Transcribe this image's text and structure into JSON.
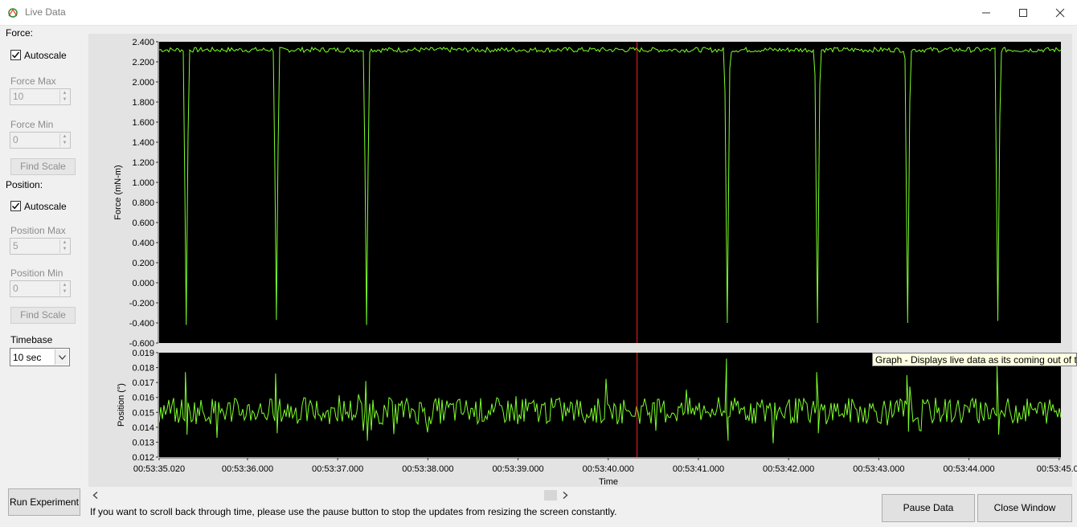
{
  "window": {
    "title": "Live Data"
  },
  "sidebar": {
    "force_section_label": "Force:",
    "force_autoscale_label": "Autoscale",
    "force_autoscale_checked": true,
    "force_max_label": "Force Max",
    "force_max_value": "10",
    "force_min_label": "Force Min",
    "force_min_value": "0",
    "force_find_scale_label": "Find Scale",
    "position_section_label": "Position:",
    "position_autoscale_label": "Autoscale",
    "position_autoscale_checked": true,
    "position_max_label": "Position Max",
    "position_max_value": "5",
    "position_min_label": "Position Min",
    "position_min_value": "0",
    "position_find_scale_label": "Find Scale",
    "timebase_label": "Timebase",
    "timebase_value": "10 sec",
    "run_experiment_label": "Run Experiment"
  },
  "footer": {
    "hint_text": "If you want to scroll back through time, please use the pause button to stop the updates from resizing the screen constantly.",
    "pause_label": "Pause Data",
    "close_label": "Close Window"
  },
  "tooltip": {
    "text": "Graph - Displays live data as its coming out of the"
  },
  "colors": {
    "trace": "#7dff2a",
    "cursor": "#ff2020",
    "plot_bg": "#000000"
  },
  "chart_data": [
    {
      "type": "line",
      "ylabel": "Force (mN-m)",
      "ylim": [
        -0.6,
        2.4
      ],
      "yticks": [
        "2.400",
        "2.200",
        "2.000",
        "1.800",
        "1.600",
        "1.400",
        "1.200",
        "1.000",
        "0.800",
        "0.600",
        "0.400",
        "0.200",
        "0.000",
        "-0.200",
        "-0.400",
        "-0.600"
      ],
      "baseline": 2.32,
      "dips": [
        {
          "t": 0.3,
          "min": -0.42
        },
        {
          "t": 1.3,
          "min": -0.37
        },
        {
          "t": 2.3,
          "min": -0.42
        },
        {
          "t": 6.3,
          "min": -0.4
        },
        {
          "t": 7.3,
          "min": -0.4
        },
        {
          "t": 8.3,
          "min": -0.4
        },
        {
          "t": 9.3,
          "min": -0.38
        }
      ]
    },
    {
      "type": "line",
      "ylabel": "Position (°)",
      "xlabel": "Time",
      "ylim": [
        0.012,
        0.019
      ],
      "yticks": [
        "0.019",
        "0.018",
        "0.017",
        "0.016",
        "0.015",
        "0.014",
        "0.013",
        "0.012"
      ],
      "xticks": [
        "00:53:35.020",
        "00:53:36.000",
        "00:53:37.000",
        "00:53:38.000",
        "00:53:39.000",
        "00:53:40.000",
        "00:53:41.000",
        "00:53:42.000",
        "00:53:43.000",
        "00:53:44.000",
        "00:53:45.0"
      ],
      "baseline": 0.0151,
      "spikes": [
        {
          "t": 0.3,
          "max": 0.0177,
          "min": 0.0135
        },
        {
          "t": 1.3,
          "max": 0.0176,
          "min": 0.0136
        },
        {
          "t": 2.3,
          "max": 0.0171,
          "min": 0.0131
        },
        {
          "t": 6.3,
          "max": 0.0186,
          "min": 0.0131
        },
        {
          "t": 7.3,
          "max": 0.0177,
          "min": 0.0136
        },
        {
          "t": 8.3,
          "max": 0.0175,
          "min": 0.0137
        },
        {
          "t": 9.3,
          "max": 0.0181,
          "min": 0.0135
        }
      ],
      "cursor_time": "00:53:40.300"
    }
  ]
}
